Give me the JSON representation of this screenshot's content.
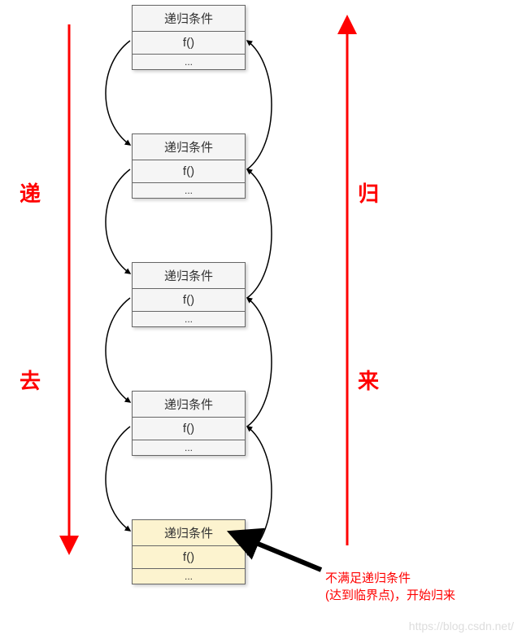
{
  "blocks": [
    {
      "header": "递归条件",
      "fn": "f()",
      "dots": "..."
    },
    {
      "header": "递归条件",
      "fn": "f()",
      "dots": "..."
    },
    {
      "header": "递归条件",
      "fn": "f()",
      "dots": "..."
    },
    {
      "header": "递归条件",
      "fn": "f()",
      "dots": "..."
    },
    {
      "header": "递归条件",
      "fn": "f()",
      "dots": "..."
    }
  ],
  "labels": {
    "left_top": "递",
    "left_bottom": "去",
    "right_top": "归",
    "right_bottom": "来"
  },
  "caption": {
    "line1": "不满足递归条件",
    "line2": "(达到临界点)，开始归来"
  },
  "watermark": "https://blog.csdn.net/"
}
